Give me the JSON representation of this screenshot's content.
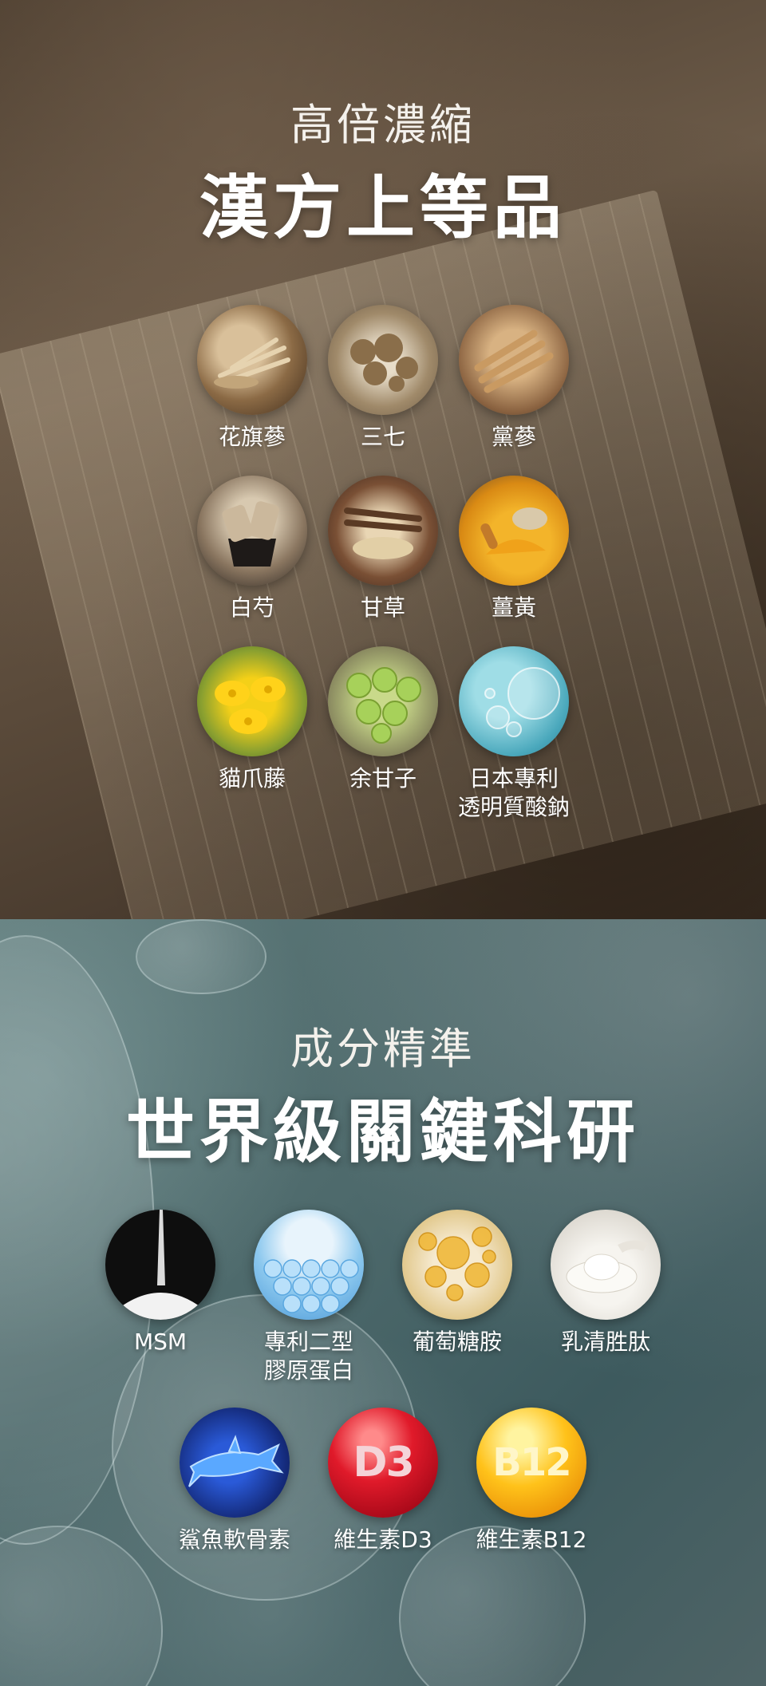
{
  "herbs": {
    "subtitle": "高倍濃縮",
    "title": "漢方上等品",
    "items": [
      {
        "label": "花旗蔘",
        "icon": "ginseng-icon",
        "color": "#8b6a45"
      },
      {
        "label": "三七",
        "icon": "sanqi-icon",
        "color": "#a08a6a"
      },
      {
        "label": "黨蔘",
        "icon": "codonopsis-icon",
        "color": "#b78a5a"
      },
      {
        "label": "白芍",
        "icon": "peony-root-icon",
        "color": "#6e5a48"
      },
      {
        "label": "甘草",
        "icon": "licorice-icon",
        "color": "#7a5035"
      },
      {
        "label": "薑黃",
        "icon": "turmeric-icon",
        "color": "#e09a1a"
      },
      {
        "label": "貓爪藤",
        "icon": "cats-claw-flower-icon",
        "color": "#e8c21a"
      },
      {
        "label": "余甘子",
        "icon": "amla-icon",
        "color": "#9ec24a"
      },
      {
        "label": "日本專利",
        "label2": "透明質酸鈉",
        "icon": "hyaluronic-bubble-icon",
        "color": "#5ab4c4"
      }
    ]
  },
  "science": {
    "subtitle": "成分精準",
    "title": "世界級關鍵科研",
    "items": [
      {
        "label": "MSM",
        "icon": "msm-powder-icon",
        "color": "#1a1a1a"
      },
      {
        "label": "專利二型",
        "label2": "膠原蛋白",
        "icon": "collagen-beads-icon",
        "color": "#6fb6e8"
      },
      {
        "label": "葡萄糖胺",
        "icon": "glucosamine-capsules-icon",
        "color": "#e6d2a0"
      },
      {
        "label": "乳清胜肽",
        "icon": "whey-powder-icon",
        "color": "#e9e6e0"
      },
      {
        "label": "鯊魚軟骨素",
        "icon": "shark-icon",
        "color": "#16308a"
      },
      {
        "label": "維生素D3",
        "icon": "vitamin-d3-icon",
        "badge": "D3",
        "color": "#c8102e"
      },
      {
        "label": "維生素B12",
        "icon": "vitamin-b12-icon",
        "badge": "B12",
        "color": "#f2a900"
      }
    ]
  }
}
